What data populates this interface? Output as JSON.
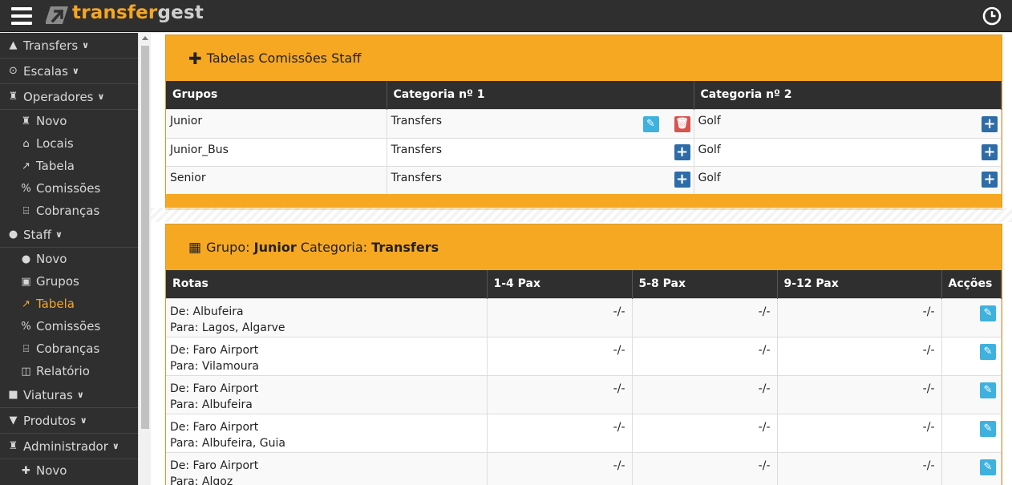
{
  "app": {
    "logo_part1": "transfer",
    "logo_part2": "gest"
  },
  "sidebar": {
    "items": [
      {
        "label": "Transfers",
        "icon": "road-icon",
        "glyph": "▲",
        "parent": true
      },
      {
        "label": "Escalas",
        "icon": "clock-icon",
        "glyph": "⊙",
        "parent": true
      },
      {
        "label": "Operadores",
        "icon": "chess-icon",
        "glyph": "♜",
        "parent": true
      },
      {
        "label": "Novo",
        "icon": "chess-icon",
        "glyph": "♜",
        "parent": false
      },
      {
        "label": "Locais",
        "icon": "home-icon",
        "glyph": "⌂",
        "parent": false
      },
      {
        "label": "Tabela",
        "icon": "line-chart-icon",
        "glyph": "↗",
        "parent": false
      },
      {
        "label": "Comissões",
        "icon": "percent-icon",
        "glyph": "%",
        "parent": false
      },
      {
        "label": "Cobranças",
        "icon": "bank-icon",
        "glyph": "⌸",
        "parent": false
      },
      {
        "label": "Staff",
        "icon": "user-icon",
        "glyph": "●",
        "parent": true
      },
      {
        "label": "Novo",
        "icon": "user-icon",
        "glyph": "●",
        "parent": false
      },
      {
        "label": "Grupos",
        "icon": "group-icon",
        "glyph": "▣",
        "parent": false
      },
      {
        "label": "Tabela",
        "icon": "line-chart-icon",
        "glyph": "↗",
        "parent": false,
        "active": true
      },
      {
        "label": "Comissões",
        "icon": "percent-icon",
        "glyph": "%",
        "parent": false
      },
      {
        "label": "Cobranças",
        "icon": "bank-icon",
        "glyph": "⌸",
        "parent": false
      },
      {
        "label": "Relatório",
        "icon": "columns-icon",
        "glyph": "◫",
        "parent": false
      },
      {
        "label": "Viaturas",
        "icon": "bus-icon",
        "glyph": "■",
        "parent": true
      },
      {
        "label": "Produtos",
        "icon": "cart-icon",
        "glyph": "▼",
        "parent": true
      },
      {
        "label": "Administrador",
        "icon": "admin-icon",
        "glyph": "♜",
        "parent": true
      },
      {
        "label": "Novo",
        "icon": "plus-icon",
        "glyph": "✚",
        "parent": false
      }
    ]
  },
  "panel1": {
    "title": "Tabelas Comissões Staff",
    "headers": [
      "Grupos",
      "Categoria nº 1",
      "Categoria nº 2"
    ],
    "rows": [
      {
        "grupo": "Junior",
        "cat1": "Transfers",
        "cat2": "Golf"
      },
      {
        "grupo": "Junior_Bus",
        "cat1": "Transfers",
        "cat2": "Golf"
      },
      {
        "grupo": "Senior",
        "cat1": "Transfers",
        "cat2": "Golf"
      }
    ]
  },
  "panel2": {
    "title_prefix": "Grupo:",
    "group": "Junior",
    "category_label": "Categoria:",
    "category": "Transfers",
    "headers": [
      "Rotas",
      "1-4 Pax",
      "5-8 Pax",
      "9-12 Pax",
      "Acções"
    ],
    "rows": [
      {
        "de": "De: Albufeira",
        "para": "Para: Lagos, Algarve",
        "p1": "-/-",
        "p2": "-/-",
        "p3": "-/-"
      },
      {
        "de": "De: Faro Airport",
        "para": "Para: Vilamoura",
        "p1": "-/-",
        "p2": "-/-",
        "p3": "-/-"
      },
      {
        "de": "De: Faro Airport",
        "para": "Para: Albufeira",
        "p1": "-/-",
        "p2": "-/-",
        "p3": "-/-"
      },
      {
        "de": "De: Faro Airport",
        "para": "Para: Albufeira, Guia",
        "p1": "-/-",
        "p2": "-/-",
        "p3": "-/-"
      },
      {
        "de": "De: Faro Airport",
        "para": "Para: Algoz",
        "p1": "-/-",
        "p2": "-/-",
        "p3": "-/-"
      }
    ]
  },
  "colors": {
    "accent": "#f7a823",
    "dark": "#2f2f2f",
    "active": "#f5a623"
  }
}
